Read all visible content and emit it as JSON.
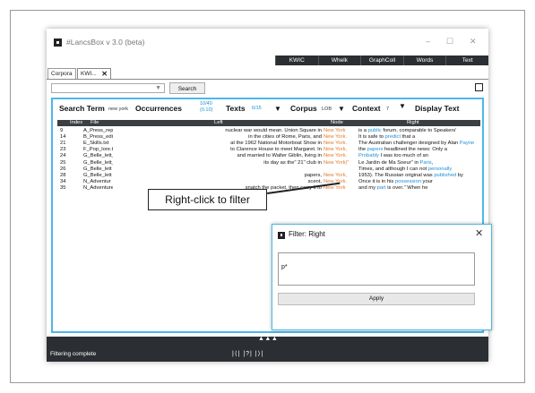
{
  "window": {
    "title": "#LancsBox v 3.0 (beta)",
    "controls": {
      "minimize": "–",
      "maximize": "☐",
      "close": "✕"
    }
  },
  "topnav": [
    "KWIC",
    "Whelk",
    "GraphColl",
    "Words",
    "Text"
  ],
  "tabs": {
    "corpora": "Corpora",
    "kwic": "KWI...",
    "close_glyph": "✕"
  },
  "controls": {
    "search_value": "",
    "search_button": "Search"
  },
  "stats": {
    "search_term_label": "Search Term",
    "search_term_value": "new york",
    "occurrences_label": "Occurrences",
    "occurrences_value": "10/40",
    "occurrences_freq": "(0.10)",
    "texts_label": "Texts",
    "texts_value": "6/15",
    "corpus_label": "Corpus",
    "corpus_value": "LOB",
    "context_label": "Context",
    "context_value": "7",
    "display_label": "Display Text",
    "caret": "▼"
  },
  "table": {
    "headers": {
      "index": "Index",
      "file": "File",
      "left": "Left",
      "node": "Node",
      "right": "Right"
    },
    "rows": [
      {
        "index": "9",
        "file": "A_Press_rep",
        "left": "nuclear war would mean. Union Square in",
        "node": "New York",
        "r1": "is a ",
        "r1h": "public",
        "r2": " forum, comparable to Speakers'",
        "r2h": "",
        "r3": ""
      },
      {
        "index": "14",
        "file": "B_Press_edit",
        "left": "in the cities of Rome, Paris, and",
        "node": "New York.",
        "r1": "It is safe to ",
        "r1h": "predict",
        "r2": " that a",
        "r2h": "",
        "r3": ""
      },
      {
        "index": "21",
        "file": "E_Skills.txt",
        "left": "at the 1962 National Motorboat Show in",
        "node": "New York.",
        "r1": "The Australian challenger designed by Alan ",
        "r1h": "Payne",
        "r2": "",
        "r2h": "",
        "r3": ""
      },
      {
        "index": "23",
        "file": "F_Pop_lore.tx",
        "left": "to Clarence House to meet Margaret. In",
        "node": "New York,",
        "r1": "the ",
        "r1h": "papers",
        "r2": " headlined the news: Only a",
        "r2h": "",
        "r3": ""
      },
      {
        "index": "24",
        "file": "G_Belle_lett_",
        "left": "and married to Walter Giblin, living in",
        "node": "New York.",
        "r1": "",
        "r1h": "Probably",
        "r2": " I was too much of an",
        "r2h": "",
        "r3": ""
      },
      {
        "index": "25",
        "file": "G_Belle_lett_",
        "left": "its day as the\" 21\" club in",
        "node": "New York)\"",
        "r1": "Le Jardin de Ma Soeur\" in ",
        "r1h": "Paris",
        "r2": ",",
        "r2h": "",
        "r3": ""
      },
      {
        "index": "26",
        "file": "G_Belle_lett",
        "left": "",
        "node": "",
        "r1": "Times, and although I can not ",
        "r1h": "personally",
        "r2": "",
        "r2h": "",
        "r3": ""
      },
      {
        "index": "28",
        "file": "G_Belle_lett",
        "left": "papers,",
        "node": "New York,",
        "r1": "1953). The Russian original was ",
        "r1h": "published",
        "r2": " by",
        "r2h": "",
        "r3": ""
      },
      {
        "index": "34",
        "file": "N_Adventur",
        "left": "scent,",
        "node": "New York.",
        "r1": "Once it is in his ",
        "r1h": "possession",
        "r2": " your",
        "r2h": "",
        "r3": ""
      },
      {
        "index": "35",
        "file": "N_Adventure:",
        "left": "snatch the packet, then carry it to",
        "node": "New York",
        "r1": "and my ",
        "r1h": "part",
        "r2": " is over.\" When he",
        "r2h": "",
        "r3": ""
      }
    ]
  },
  "bottombar": {
    "arrows": "▲▲▲"
  },
  "status": {
    "text": "Filtering complete",
    "page_nav": "|⟨| |?| |⟩|"
  },
  "callout": {
    "text": "Right-click to filter"
  },
  "dialog": {
    "title": "Filter: Right",
    "close": "✕",
    "input_value": "p*",
    "apply_label": "Apply"
  },
  "colors": {
    "accent": "#4db8e8",
    "node": "#e07a2b",
    "link": "#1a8fd8",
    "dark": "#2b2f33"
  }
}
